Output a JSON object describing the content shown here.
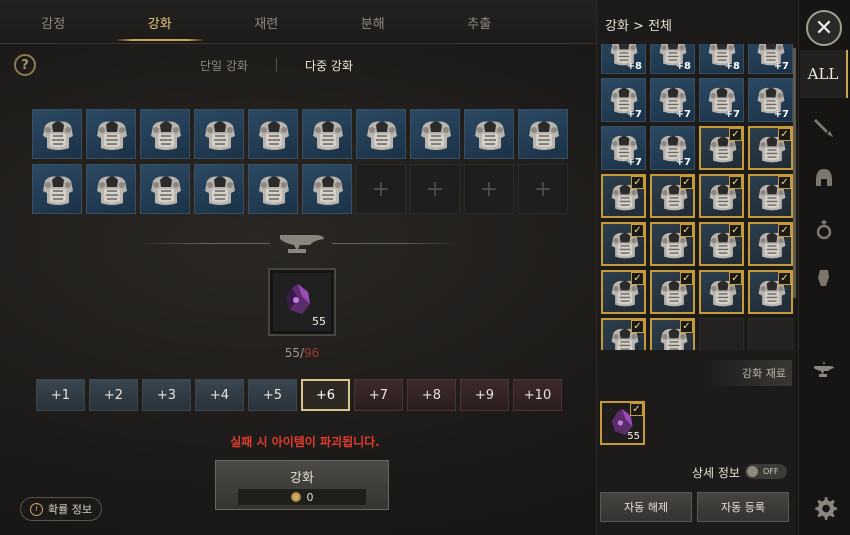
{
  "tabs": [
    {
      "label": "감정",
      "active": false
    },
    {
      "label": "강화",
      "active": true
    },
    {
      "label": "재련",
      "active": false
    },
    {
      "label": "분해",
      "active": false
    },
    {
      "label": "추출",
      "active": false
    }
  ],
  "help_label": "?",
  "subtabs": {
    "single": "단일 강화",
    "multi": "다중 강화"
  },
  "empty_slot_glyph": "+",
  "material": {
    "count": "55",
    "have": "55",
    "sep": "/",
    "need": "96"
  },
  "levels": [
    {
      "label": "+1",
      "state": "low"
    },
    {
      "label": "+2",
      "state": "low"
    },
    {
      "label": "+3",
      "state": "low"
    },
    {
      "label": "+4",
      "state": "low"
    },
    {
      "label": "+5",
      "state": "low"
    },
    {
      "label": "+6",
      "state": "sel"
    },
    {
      "label": "+7",
      "state": "high"
    },
    {
      "label": "+8",
      "state": "high"
    },
    {
      "label": "+9",
      "state": "high"
    },
    {
      "label": "+10",
      "state": "high"
    }
  ],
  "warning": "실패 시 아이템이 파괴됩니다.",
  "enhance_button": {
    "label": "강화",
    "cost": "0"
  },
  "probability": {
    "icon": "i",
    "label": "확률 정보"
  },
  "right_panel": {
    "title": "강화 > 전체",
    "inventory": [
      {
        "lv": "+8",
        "checked": false
      },
      {
        "lv": "+8",
        "checked": false
      },
      {
        "lv": "+8",
        "checked": false
      },
      {
        "lv": "+7",
        "checked": false
      },
      {
        "lv": "+7",
        "checked": false
      },
      {
        "lv": "+7",
        "checked": false
      },
      {
        "lv": "+7",
        "checked": false
      },
      {
        "lv": "+7",
        "checked": false
      },
      {
        "lv": "+7",
        "checked": false
      },
      {
        "lv": "+7",
        "checked": false
      },
      {
        "lv": "",
        "checked": true
      },
      {
        "lv": "",
        "checked": true
      },
      {
        "lv": "",
        "checked": true
      },
      {
        "lv": "",
        "checked": true
      },
      {
        "lv": "",
        "checked": true
      },
      {
        "lv": "",
        "checked": true
      },
      {
        "lv": "",
        "checked": true
      },
      {
        "lv": "",
        "checked": true
      },
      {
        "lv": "",
        "checked": true
      },
      {
        "lv": "",
        "checked": true
      },
      {
        "lv": "",
        "checked": true
      },
      {
        "lv": "",
        "checked": true
      },
      {
        "lv": "",
        "checked": true
      },
      {
        "lv": "",
        "checked": true
      },
      {
        "lv": "",
        "checked": true
      },
      {
        "lv": "",
        "checked": true
      },
      {
        "lv": null,
        "checked": false
      },
      {
        "lv": null,
        "checked": false
      }
    ],
    "material_header": "강화 재료",
    "material_count": "55",
    "check_glyph": "✓",
    "detail_label": "상세 정보",
    "toggle_text": "OFF",
    "auto_release": "자동 해제",
    "auto_register": "자동 등록"
  },
  "rail": {
    "close": "✕",
    "all": "ALL"
  },
  "colors": {
    "accent": "#c9a55a",
    "warning": "#e13b2e",
    "need": "#9b3b33",
    "slot_blue": "#2c4a64"
  }
}
